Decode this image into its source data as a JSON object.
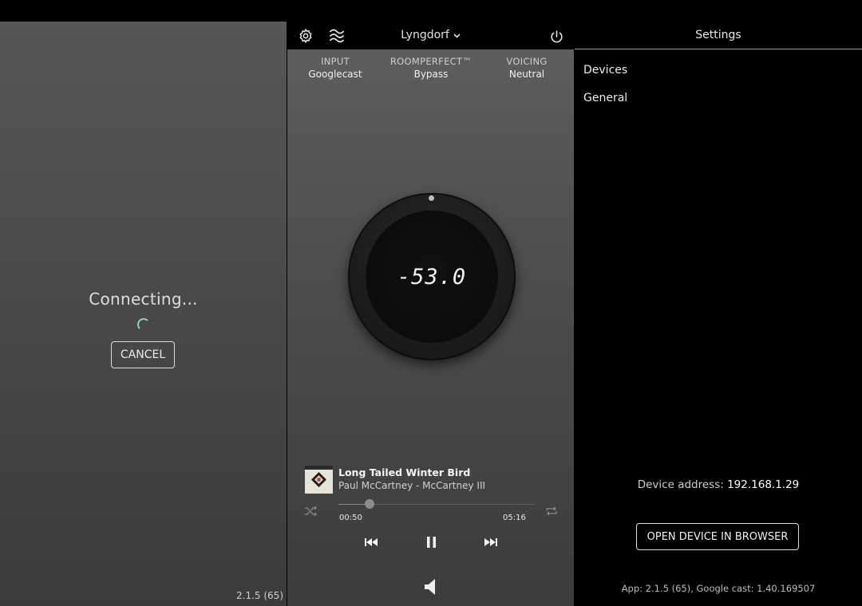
{
  "connect_screen": {
    "status_text": "Connecting...",
    "cancel_label": "CANCEL",
    "version": "2.1.5 (65)"
  },
  "player": {
    "icons": [
      "gear-icon",
      "waves-icon",
      "chevron-down-icon",
      "power-icon",
      "shuffle-icon",
      "repeat-icon",
      "previous-icon",
      "pause-icon",
      "next-icon",
      "speaker-icon"
    ],
    "device_name": "Lyngdorf",
    "status": [
      {
        "label": "INPUT",
        "value": "Googlecast"
      },
      {
        "label": "ROOMPERFECT™",
        "value": "Bypass"
      },
      {
        "label": "VOICING",
        "value": "Neutral"
      }
    ],
    "volume": "-53.0",
    "track": {
      "title": "Long Tailed Winter Bird",
      "artist_album": "Paul McCartney - McCartney III",
      "elapsed": "00:50",
      "duration": "05:16",
      "progress": 0.16
    },
    "colors": {
      "spinner": "#8fd0c6",
      "knob": "#1d1d1d"
    }
  },
  "settings": {
    "title": "Settings",
    "menu": [
      "Devices",
      "General"
    ],
    "device_address_label": "Device address:",
    "device_address": "192.168.1.29",
    "open_button_label": "OPEN DEVICE IN BROWSER",
    "footer": "App: 2.1.5 (65), Google cast: 1.40.169507"
  }
}
